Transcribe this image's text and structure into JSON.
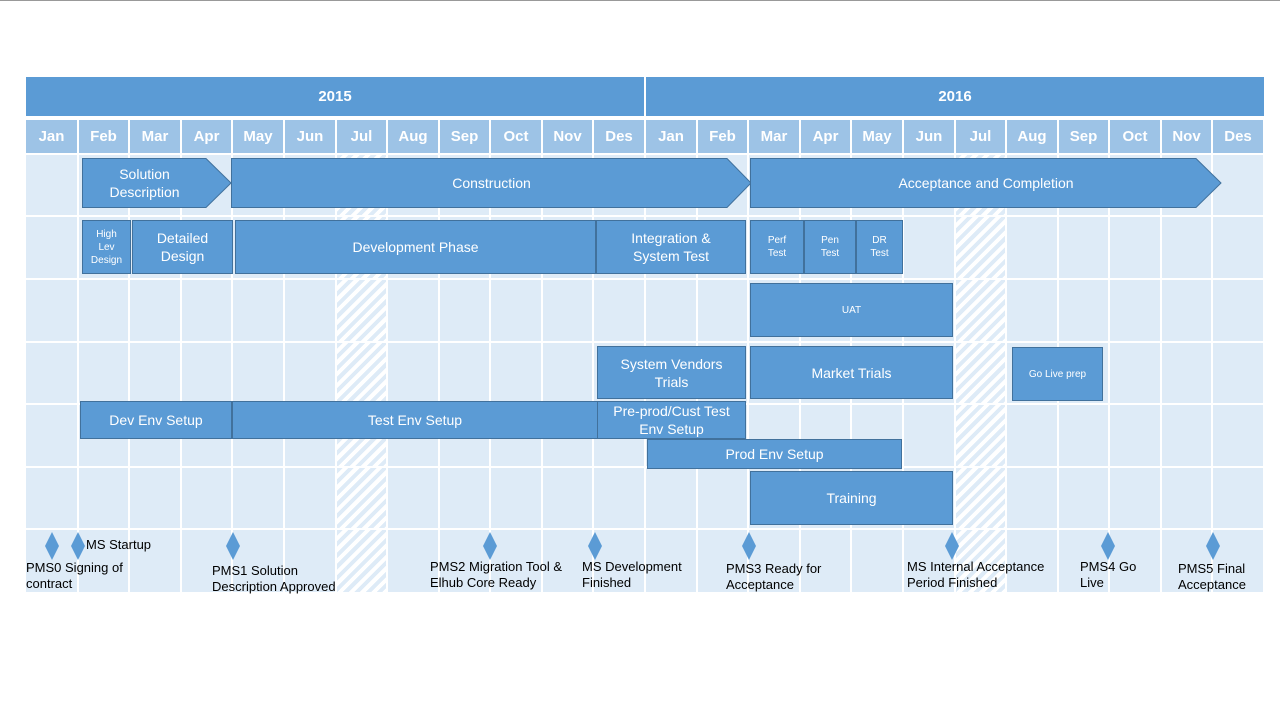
{
  "years": [
    "2015",
    "2016"
  ],
  "months": [
    "Jan",
    "Feb",
    "Mar",
    "Apr",
    "May",
    "Jun",
    "Jul",
    "Aug",
    "Sep",
    "Oct",
    "Nov",
    "Des",
    "Jan",
    "Feb",
    "Mar",
    "Apr",
    "May",
    "Jun",
    "Jul",
    "Aug",
    "Sep",
    "Oct",
    "Nov",
    "Des"
  ],
  "phases": [
    "Solution Description",
    "Construction",
    "Acceptance and Completion"
  ],
  "tasks": {
    "high_lev": "High Lev Design",
    "detailed": "Detailed Design",
    "development": "Development Phase",
    "integration": "Integration & System Test",
    "perf": "Perf Test",
    "pen": "Pen Test",
    "dr": "DR Test",
    "uat": "UAT",
    "vendors": "System Vendors Trials",
    "market": "Market Trials",
    "golive": "Go Live prep",
    "dev_env": "Dev Env Setup",
    "test_env": "Test Env Setup",
    "preprod": "Pre-prod/Cust Test Env Setup",
    "prod_env": "Prod Env Setup",
    "training": "Training"
  },
  "milestones": [
    "PMS0 Signing of contract",
    "MS Startup",
    "PMS1 Solution Description Approved",
    "PMS2 Migration Tool & Elhub Core Ready",
    "MS Development Finished",
    "PMS3 Ready for Acceptance",
    "MS Internal Acceptance Period Finished",
    "PMS4 Go Live",
    "PMS5 Final Acceptance"
  ],
  "colors": {
    "bar": "#5b9bd5",
    "month_header": "#9dc3e6",
    "cell": "#deebf7",
    "milestone": "#5b9bd5"
  }
}
